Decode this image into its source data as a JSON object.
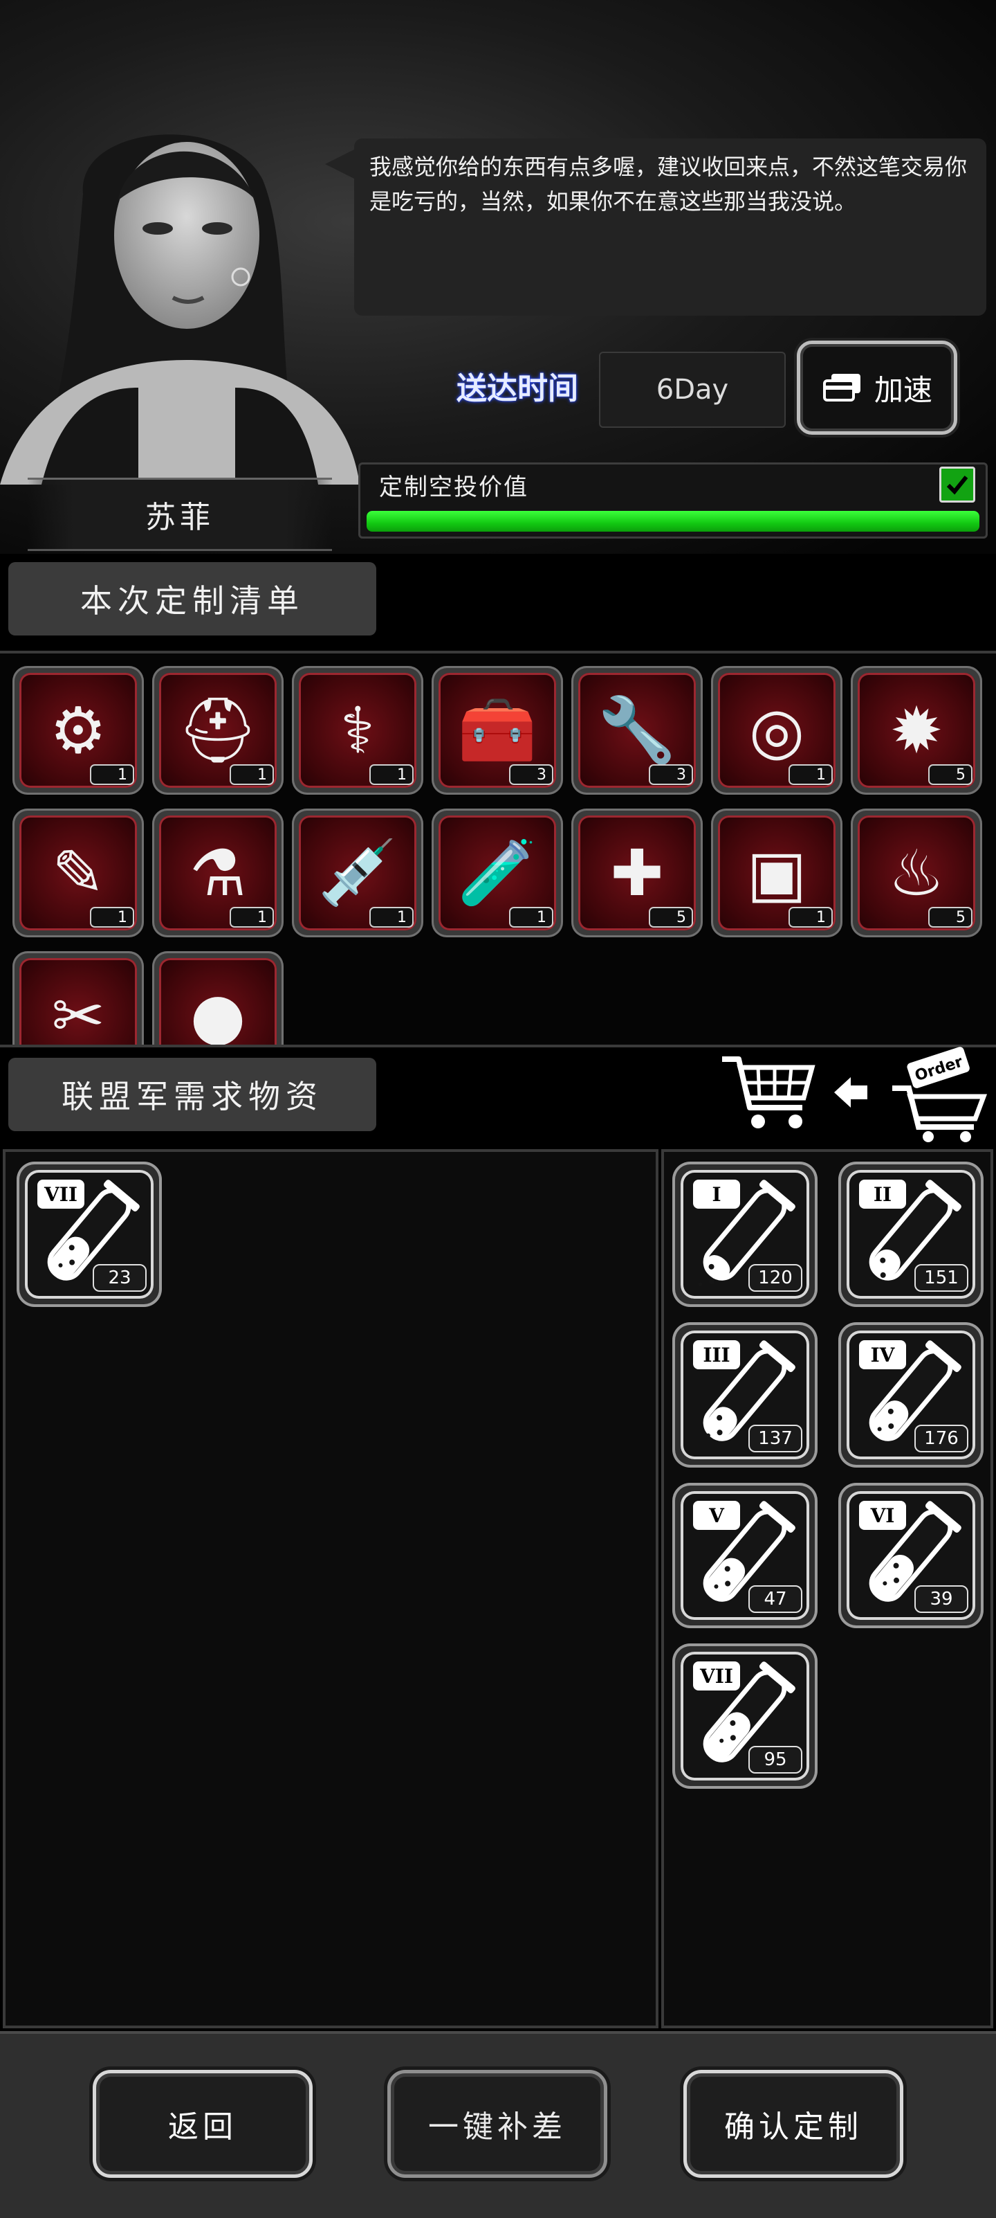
{
  "npc": {
    "name": "苏菲",
    "dialogue": "我感觉你给的东西有点多喔，建议收回来点，不然这笔交易你是吃亏的，当然，如果你不在意这些那当我没说。"
  },
  "delivery": {
    "label": "送达时间",
    "value": "6Day",
    "speed_button": "加速"
  },
  "airdrop_value": {
    "label": "定制空投价值",
    "progress": 1.0,
    "checked": true
  },
  "order_list": {
    "title": "本次定制清单",
    "items": [
      {
        "icon": "machine-part-icon",
        "glyph": "⚙",
        "qty": "1"
      },
      {
        "icon": "helmet-icon",
        "glyph": "⛑",
        "qty": "1"
      },
      {
        "icon": "medical-kit-icon",
        "glyph": "⚕",
        "qty": "1"
      },
      {
        "icon": "toolbox-icon",
        "glyph": "🧰",
        "qty": "3"
      },
      {
        "icon": "tool-case-icon",
        "glyph": "🔧",
        "qty": "3"
      },
      {
        "icon": "coin-icon",
        "glyph": "◎",
        "qty": "1"
      },
      {
        "icon": "grenade-icon",
        "glyph": "✹",
        "qty": "5"
      },
      {
        "icon": "syringe-pen-icon",
        "glyph": "✎",
        "qty": "1"
      },
      {
        "icon": "test-tube-icon",
        "glyph": "⚗",
        "qty": "1"
      },
      {
        "icon": "syringe-icon",
        "glyph": "💉",
        "qty": "1"
      },
      {
        "icon": "bottle-icon",
        "glyph": "🧪",
        "qty": "1"
      },
      {
        "icon": "injector-icon",
        "glyph": "✚",
        "qty": "5"
      },
      {
        "icon": "battery-icon",
        "glyph": "▣",
        "qty": "1"
      },
      {
        "icon": "explosive-icon",
        "glyph": "♨",
        "qty": "5"
      },
      {
        "icon": "pliers-icon",
        "glyph": "✂",
        "qty": ""
      },
      {
        "icon": "capsule-icon",
        "glyph": "●",
        "qty": ""
      }
    ]
  },
  "demand": {
    "title": "联盟军需求物资",
    "items": [
      {
        "tier": "VII",
        "qty": "23",
        "fill": 0.55
      }
    ]
  },
  "stock": {
    "items": [
      {
        "tier": "I",
        "qty": "120",
        "fill": 0.25
      },
      {
        "tier": "II",
        "qty": "151",
        "fill": 0.35
      },
      {
        "tier": "III",
        "qty": "137",
        "fill": 0.4
      },
      {
        "tier": "IV",
        "qty": "176",
        "fill": 0.5
      },
      {
        "tier": "V",
        "qty": "47",
        "fill": 0.55
      },
      {
        "tier": "VI",
        "qty": "39",
        "fill": 0.6
      },
      {
        "tier": "VII",
        "qty": "95",
        "fill": 0.65
      }
    ]
  },
  "cart": {
    "order_tag": "Order"
  },
  "footer": {
    "back": "返回",
    "fill_gap": "一键补差",
    "confirm": "确认定制"
  },
  "colors": {
    "progress_green": "#12c812",
    "item_bg_red": "#6e0f16",
    "accent_blue_glow": "#2a4bff"
  }
}
